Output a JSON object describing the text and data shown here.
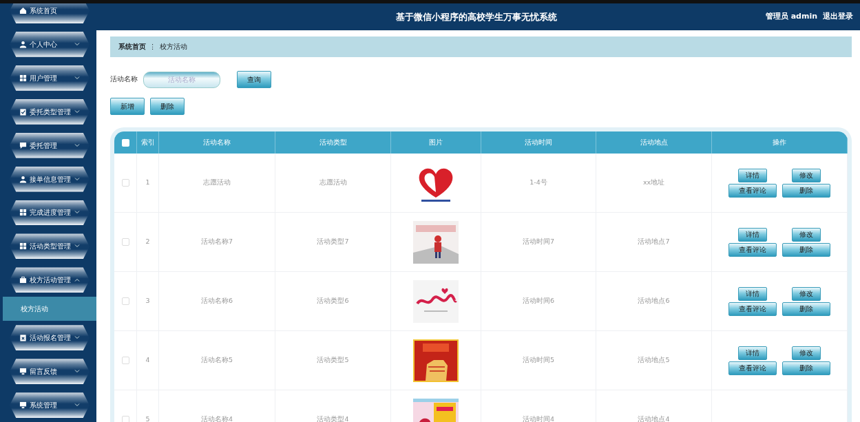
{
  "header": {
    "title": "基于微信小程序的高校学生万事无忧系统",
    "user": "管理员 admin",
    "logout": "退出登录"
  },
  "sidebar": {
    "items": [
      {
        "label": "系统首页"
      },
      {
        "label": "个人中心",
        "expanded": false
      },
      {
        "label": "用户管理",
        "expanded": false
      },
      {
        "label": "委托类型管理",
        "expanded": false
      },
      {
        "label": "委托管理",
        "expanded": false
      },
      {
        "label": "接单信息管理",
        "expanded": false
      },
      {
        "label": "完成进度管理",
        "expanded": false
      },
      {
        "label": "活动类型管理",
        "expanded": false
      },
      {
        "label": "校方活动管理",
        "expanded": true,
        "children": [
          {
            "label": "校方活动",
            "selected": true
          }
        ]
      },
      {
        "label": "活动报名管理",
        "expanded": false
      },
      {
        "label": "留言反馈",
        "expanded": false
      },
      {
        "label": "系统管理",
        "expanded": false
      }
    ]
  },
  "breadcrumb": [
    {
      "label": "系统首页",
      "current": false
    },
    {
      "label": "校方活动",
      "current": true
    }
  ],
  "breadcrumb_separator": "⋮",
  "search": {
    "label": "活动名称",
    "placeholder": "活动名称",
    "button": "查询"
  },
  "toolbar": [
    "新增",
    "删除"
  ],
  "table": {
    "header_checked": false,
    "columns": [
      "索引",
      "活动名称",
      "活动类型",
      "图片",
      "活动时间",
      "活动地点",
      "操作"
    ],
    "rows": [
      {
        "checked": false,
        "index": "1",
        "name": "志愿活动",
        "type": "志愿活动",
        "picture": {
          "kind": "picture"
        },
        "time": "1-4号",
        "place": "xx地址",
        "actions": [
          "详情",
          "修改",
          "查看评论",
          "删除"
        ]
      },
      {
        "checked": false,
        "index": "2",
        "name": "活动名称7",
        "type": "活动类型7",
        "picture": {
          "kind": "picture"
        },
        "time": "活动时间7",
        "place": "活动地点7",
        "actions": [
          "详情",
          "修改",
          "查看评论",
          "删除"
        ]
      },
      {
        "checked": false,
        "index": "3",
        "name": "活动名称6",
        "type": "活动类型6",
        "picture": {
          "kind": "picture"
        },
        "time": "活动时间6",
        "place": "活动地点6",
        "actions": [
          "详情",
          "修改",
          "查看评论",
          "删除"
        ]
      },
      {
        "checked": false,
        "index": "4",
        "name": "活动名称5",
        "type": "活动类型5",
        "picture": {
          "kind": "picture"
        },
        "time": "活动时间5",
        "place": "活动地点5",
        "actions": [
          "详情",
          "修改",
          "查看评论",
          "删除"
        ]
      },
      {
        "checked": false,
        "index": "5",
        "name": "活动名称4",
        "type": "活动类型4",
        "picture": {
          "kind": "picture"
        },
        "time": "活动时间4",
        "place": "活动地点4"
      }
    ]
  }
}
